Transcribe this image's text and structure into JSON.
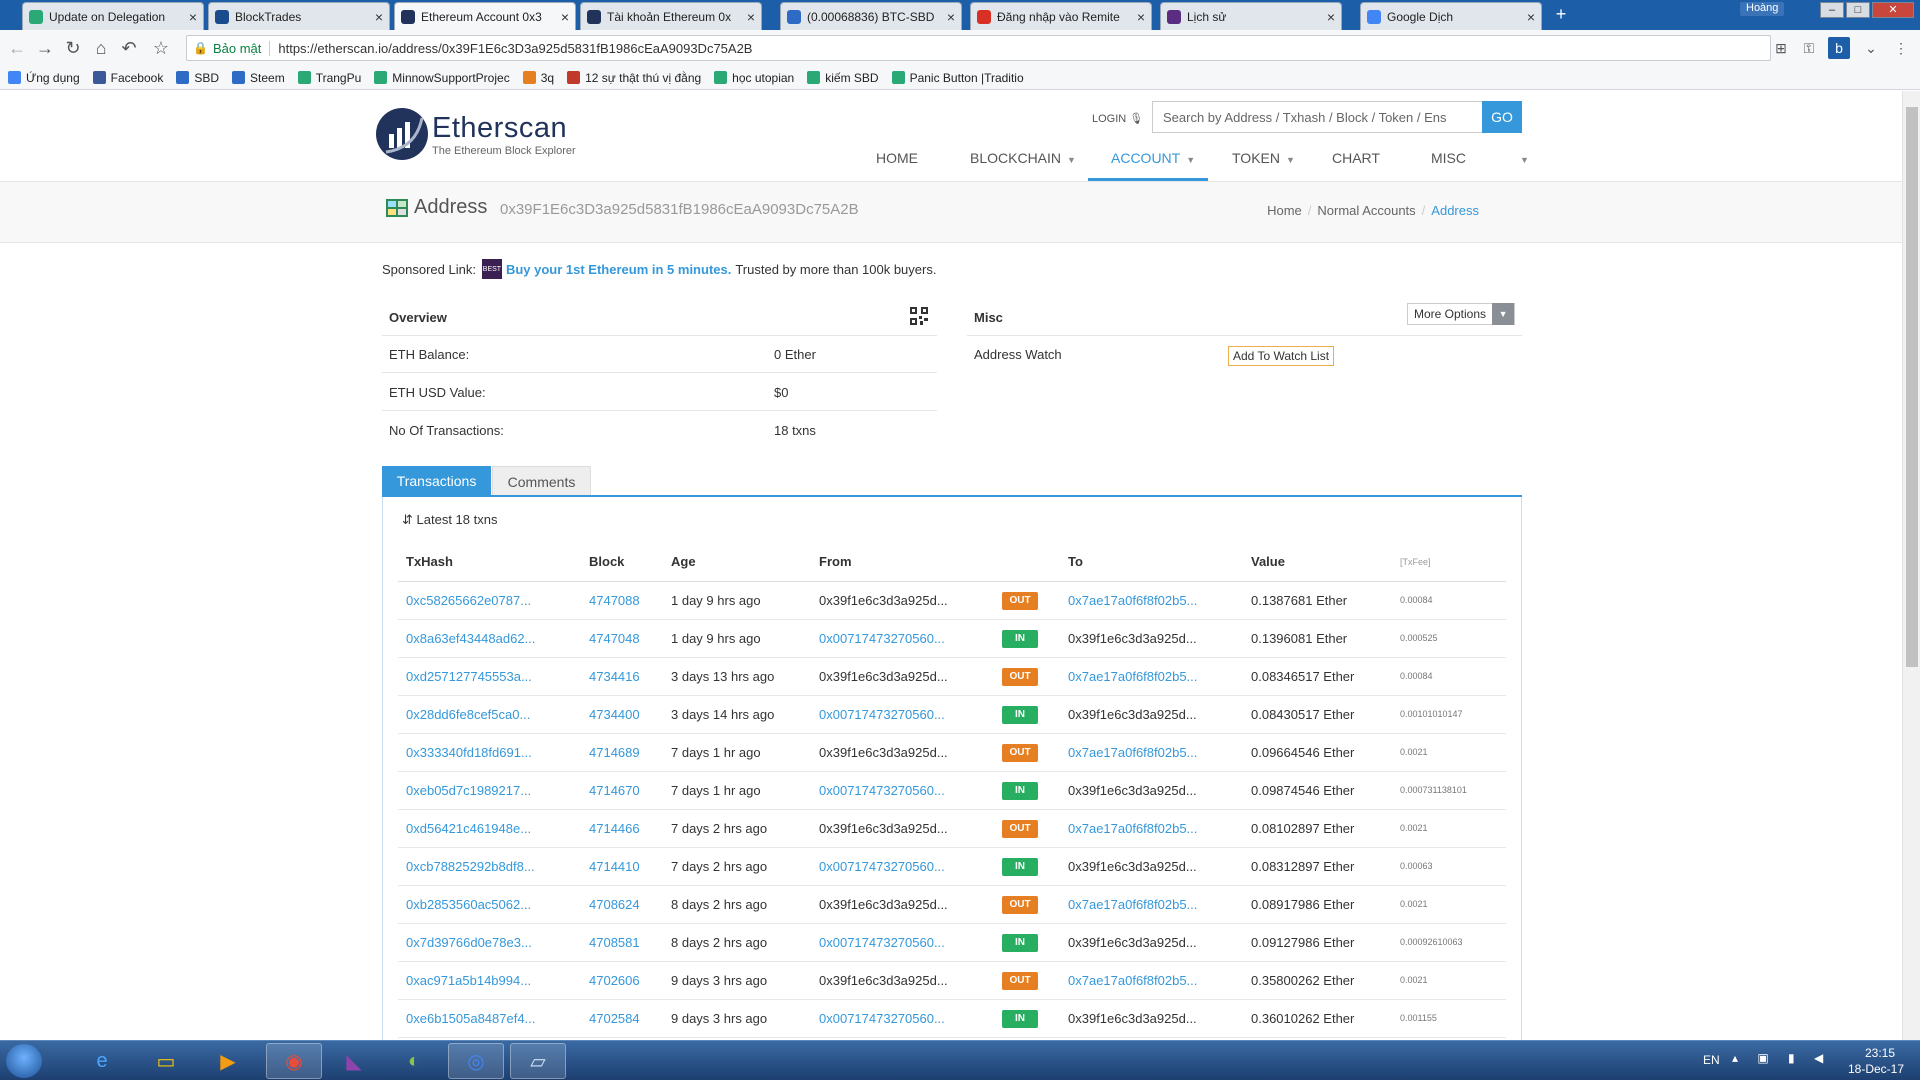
{
  "browser": {
    "tabs": [
      {
        "title": "Update on Delegation",
        "color": "#2aa876"
      },
      {
        "title": "BlockTrades",
        "color": "#1a4b8c"
      },
      {
        "title": "Ethereum Account 0x3",
        "color": "#21325b"
      },
      {
        "title": "Tài khoản Ethereum 0x",
        "color": "#21325b"
      },
      {
        "title": "(0.00068836) BTC-SBD",
        "color": "#2e6bc4"
      },
      {
        "title": "Đăng nhập vào Remite",
        "color": "#d93025"
      },
      {
        "title": "Lịch sử",
        "color": "#5a2d82"
      },
      {
        "title": "Google Dịch",
        "color": "#4285f4"
      }
    ],
    "user_badge": "Hoàng",
    "secure_label": "Bảo mật",
    "url": "https://etherscan.io/address/0x39F1E6c3D3a925d5831fB1986cEaA9093Dc75A2B",
    "bookmarks": [
      {
        "label": "Ứng dụng",
        "color": "#4285f4"
      },
      {
        "label": "Facebook",
        "color": "#3b5998"
      },
      {
        "label": "SBD",
        "color": "#2e6bc4"
      },
      {
        "label": "Steem",
        "color": "#2e6bc4"
      },
      {
        "label": "TrangPu",
        "color": "#2aa876"
      },
      {
        "label": "MinnowSupportProjec",
        "color": "#2aa876"
      },
      {
        "label": "3q",
        "color": "#e67e22"
      },
      {
        "label": "12 sự thật thú vị đằng",
        "color": "#c0392b"
      },
      {
        "label": "học utopian",
        "color": "#2aa876"
      },
      {
        "label": "kiếm SBD",
        "color": "#2aa876"
      },
      {
        "label": "Panic Button |Traditio",
        "color": "#2aa876"
      }
    ]
  },
  "site": {
    "logo_word": "Etherscan",
    "logo_tagline": "The Ethereum Block Explorer",
    "login": "LOGIN",
    "search_placeholder": "Search by Address / Txhash / Block / Token / Ens",
    "search_button": "GO",
    "menu": [
      "HOME",
      "BLOCKCHAIN",
      "ACCOUNT",
      "TOKEN",
      "CHART",
      "MISC"
    ],
    "active_menu": "ACCOUNT"
  },
  "address": {
    "label": "Address",
    "value": "0x39F1E6c3D3a925d5831fB1986cEaA9093Dc75A2B",
    "breadcrumbs": [
      "Home",
      "Normal Accounts",
      "Address"
    ]
  },
  "sponsor": {
    "prefix": "Sponsored Link:",
    "icon_text": "BEST",
    "link": "Buy your 1st Ethereum in 5 minutes.",
    "suffix": "Trusted by more than 100k buyers."
  },
  "overview": {
    "title": "Overview",
    "rows": [
      {
        "label": "ETH Balance:",
        "value": "0 Ether"
      },
      {
        "label": "ETH USD Value:",
        "value": "$0"
      },
      {
        "label": "No Of Transactions:",
        "value": "18 txns"
      }
    ]
  },
  "misc": {
    "title": "Misc",
    "more_options": "More Options",
    "watch_label": "Address Watch",
    "watch_button": "Add To Watch List"
  },
  "tx_tabs": {
    "transactions": "Transactions",
    "comments": "Comments"
  },
  "latest": "Latest 18 txns",
  "columns": [
    "TxHash",
    "Block",
    "Age",
    "From",
    "",
    "To",
    "Value",
    "[TxFee]"
  ],
  "transactions": [
    {
      "hash": "0xc58265662e0787...",
      "block": "4747088",
      "age": "1 day 9 hrs ago",
      "from": "0x39f1e6c3d3a925d...",
      "dir": "OUT",
      "to": "0x7ae17a0f6f8f02b5...",
      "value": "0.1387681 Ether",
      "fee": "0.00084"
    },
    {
      "hash": "0x8a63ef43448ad62...",
      "block": "4747048",
      "age": "1 day 9 hrs ago",
      "from": "0x00717473270560...",
      "dir": "IN",
      "to": "0x39f1e6c3d3a925d...",
      "value": "0.1396081 Ether",
      "fee": "0.000525"
    },
    {
      "hash": "0xd257127745553a...",
      "block": "4734416",
      "age": "3 days 13 hrs ago",
      "from": "0x39f1e6c3d3a925d...",
      "dir": "OUT",
      "to": "0x7ae17a0f6f8f02b5...",
      "value": "0.08346517 Ether",
      "fee": "0.00084"
    },
    {
      "hash": "0x28dd6fe8cef5ca0...",
      "block": "4734400",
      "age": "3 days 14 hrs ago",
      "from": "0x00717473270560...",
      "dir": "IN",
      "to": "0x39f1e6c3d3a925d...",
      "value": "0.08430517 Ether",
      "fee": "0.00101010147"
    },
    {
      "hash": "0x333340fd18fd691...",
      "block": "4714689",
      "age": "7 days 1 hr ago",
      "from": "0x39f1e6c3d3a925d...",
      "dir": "OUT",
      "to": "0x7ae17a0f6f8f02b5...",
      "value": "0.09664546 Ether",
      "fee": "0.0021"
    },
    {
      "hash": "0xeb05d7c1989217...",
      "block": "4714670",
      "age": "7 days 1 hr ago",
      "from": "0x00717473270560...",
      "dir": "IN",
      "to": "0x39f1e6c3d3a925d...",
      "value": "0.09874546 Ether",
      "fee": "0.000731138101"
    },
    {
      "hash": "0xd56421c461948e...",
      "block": "4714466",
      "age": "7 days 2 hrs ago",
      "from": "0x39f1e6c3d3a925d...",
      "dir": "OUT",
      "to": "0x7ae17a0f6f8f02b5...",
      "value": "0.08102897 Ether",
      "fee": "0.0021"
    },
    {
      "hash": "0xcb78825292b8df8...",
      "block": "4714410",
      "age": "7 days 2 hrs ago",
      "from": "0x00717473270560...",
      "dir": "IN",
      "to": "0x39f1e6c3d3a925d...",
      "value": "0.08312897 Ether",
      "fee": "0.00063"
    },
    {
      "hash": "0xb2853560ac5062...",
      "block": "4708624",
      "age": "8 days 2 hrs ago",
      "from": "0x39f1e6c3d3a925d...",
      "dir": "OUT",
      "to": "0x7ae17a0f6f8f02b5...",
      "value": "0.08917986 Ether",
      "fee": "0.0021"
    },
    {
      "hash": "0x7d39766d0e78e3...",
      "block": "4708581",
      "age": "8 days 2 hrs ago",
      "from": "0x00717473270560...",
      "dir": "IN",
      "to": "0x39f1e6c3d3a925d...",
      "value": "0.09127986 Ether",
      "fee": "0.00092610063"
    },
    {
      "hash": "0xac971a5b14b994...",
      "block": "4702606",
      "age": "9 days 3 hrs ago",
      "from": "0x39f1e6c3d3a925d...",
      "dir": "OUT",
      "to": "0x7ae17a0f6f8f02b5...",
      "value": "0.35800262 Ether",
      "fee": "0.0021"
    },
    {
      "hash": "0xe6b1505a8487ef4...",
      "block": "4702584",
      "age": "9 days 3 hrs ago",
      "from": "0x00717473270560...",
      "dir": "IN",
      "to": "0x39f1e6c3d3a925d...",
      "value": "0.36010262 Ether",
      "fee": "0.001155"
    }
  ],
  "taskbar": {
    "lang": "EN",
    "time": "23:15",
    "date": "18-Dec-17"
  }
}
